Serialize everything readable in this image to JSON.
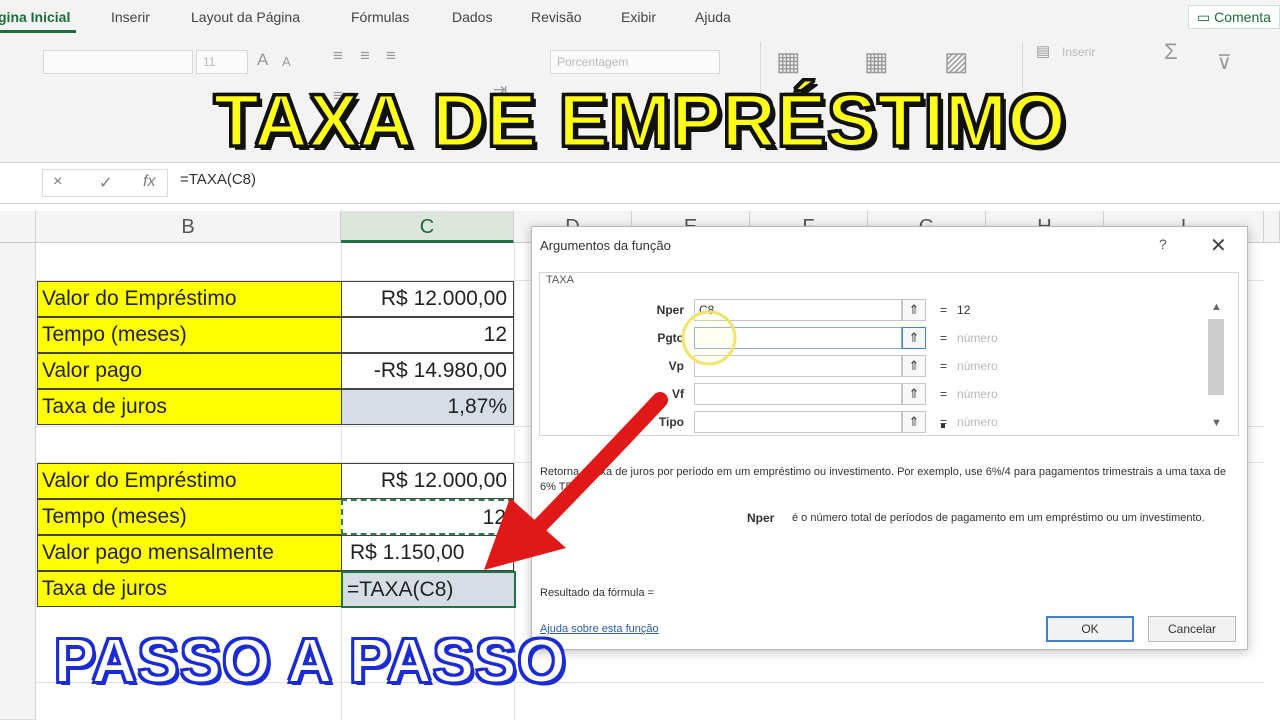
{
  "ribbon": {
    "tabs": [
      "gina Inicial",
      "Inserir",
      "Layout da Página",
      "Fórmulas",
      "Dados",
      "Revisão",
      "Exibir",
      "Ajuda"
    ],
    "comments_button": "Comenta",
    "font_size": "11",
    "number_format": "Porcentagem",
    "insert_label": "Inserir"
  },
  "formula_bar": {
    "cancel_icon": "×",
    "confirm_icon": "✓",
    "fx_icon": "fx",
    "formula": "=TAXA(C8)"
  },
  "columns": [
    "B",
    "C",
    "D",
    "E",
    "F",
    "G",
    "H",
    "I"
  ],
  "table1": [
    {
      "label": "Valor do Empréstimo",
      "value": "R$ 12.000,00"
    },
    {
      "label": "Tempo (meses)",
      "value": "12"
    },
    {
      "label": "Valor pago",
      "value": "-R$ 14.980,00"
    },
    {
      "label": "Taxa de juros",
      "value": "1,87%"
    }
  ],
  "table2": [
    {
      "label": "Valor do Empréstimo",
      "value": "R$ 12.000,00"
    },
    {
      "label": "Tempo (meses)",
      "value": "12"
    },
    {
      "label": "Valor pago mensalmente",
      "value": "R$    1.150,00"
    },
    {
      "label": "Taxa de juros",
      "value": "=TAXA(C8)"
    }
  ],
  "dialog": {
    "title": "Argumentos da função",
    "help": "?",
    "close": "✕",
    "function_name": "TAXA",
    "arguments": [
      {
        "name": "Nper",
        "value": "C8",
        "result": "12"
      },
      {
        "name": "Pgto",
        "value": "",
        "result": "número"
      },
      {
        "name": "Vp",
        "value": "",
        "result": "número"
      },
      {
        "name": "Vf",
        "value": "",
        "result": "número"
      },
      {
        "name": "Tipo",
        "value": "",
        "result": "número"
      }
    ],
    "description": "Retorna a taxa de juros por período em um empréstimo ou investimento. Por exemplo, use 6%/4 para pagamentos trimestrais a uma taxa de 6% TPA.",
    "arg_help_name": "Nper",
    "arg_help_text": "é o número total de períodos de pagamento em um empréstimo ou um investimento.",
    "result_label": "Resultado da fórmula =",
    "help_link": "Ajuda sobre esta função",
    "ok": "OK",
    "cancel": "Cancelar"
  },
  "overlay": {
    "headline": "TAXA DE EMPRÉSTIMO",
    "subline": "PASSO A PASSO"
  },
  "colors": {
    "excel_green": "#217346",
    "label_fill": "#ffff00",
    "selected_fill": "#d7dde5",
    "arrow": "#e01818",
    "headline": "#ffff1a",
    "subline_stroke": "#1b2bd6"
  }
}
